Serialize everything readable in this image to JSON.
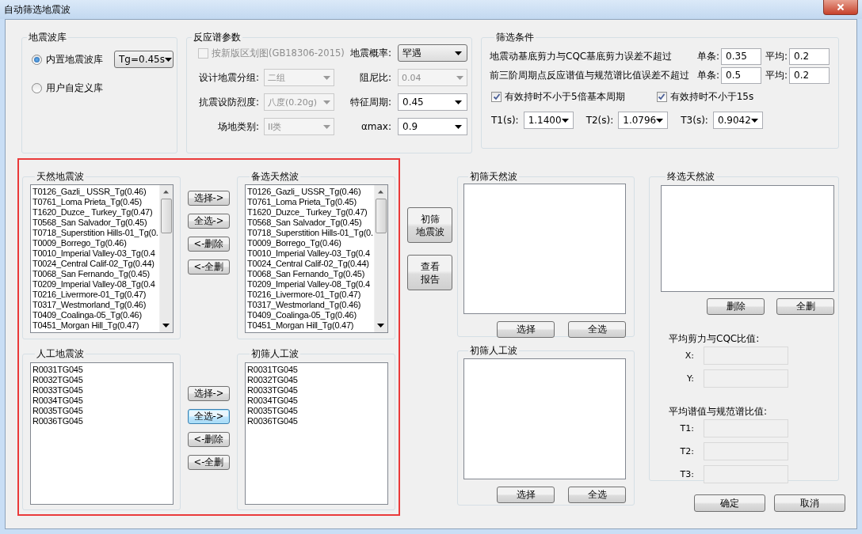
{
  "window": {
    "title": "自动筛选地震波"
  },
  "wave_library": {
    "title": "地震波库",
    "options": [
      {
        "label": "内置地震波库",
        "selected": true
      },
      {
        "label": "用户自定义库",
        "selected": false
      }
    ],
    "tg_select": {
      "value": "Tg=0.45s"
    }
  },
  "spectrum_params": {
    "title": "反应谱参数",
    "new_zoning": {
      "label": "按新版区划图(GB18306-2015)",
      "checked": false,
      "disabled": true
    },
    "left_fields": [
      {
        "label": "设计地震分组:",
        "value": "二组",
        "disabled": true
      },
      {
        "label": "抗震设防烈度:",
        "value": "八度(0.20g)",
        "disabled": true
      },
      {
        "label": "场地类别:",
        "value": "II类",
        "disabled": true
      }
    ],
    "right_fields": [
      {
        "label": "地震概率:",
        "value": "罕遇",
        "disabled": false,
        "kind": "button"
      },
      {
        "label": "阻尼比:",
        "value": "0.04",
        "disabled": true,
        "kind": "edit"
      },
      {
        "label": "特征周期:",
        "value": "0.45",
        "disabled": false,
        "kind": "edit"
      },
      {
        "label": "αmax:",
        "value": "0.9",
        "disabled": false,
        "kind": "edit"
      }
    ]
  },
  "filter": {
    "title": "筛选条件",
    "criteria": [
      {
        "label": "地震动基底剪力与CQC基底剪力误差不超过",
        "single_label": "单条:",
        "single": "0.35",
        "avg_label": "平均:",
        "avg": "0.2"
      },
      {
        "label": "前三阶周期点反应谱值与规范谱比值误差不超过",
        "single_label": "单条:",
        "single": "0.5",
        "avg_label": "平均:",
        "avg": "0.2"
      }
    ],
    "checks": [
      {
        "label": "有效持时不小于5倍基本周期",
        "checked": true
      },
      {
        "label": "有效持时不小于15s",
        "checked": true
      }
    ],
    "periods": [
      {
        "label": "T1(s):",
        "value": "1.1400"
      },
      {
        "label": "T2(s):",
        "value": "1.0796"
      },
      {
        "label": "T3(s):",
        "value": "0.9042"
      }
    ]
  },
  "natural_waves": {
    "title": "天然地震波",
    "items": [
      "T0126_Gazli_ USSR_Tg(0.46)",
      "T0761_Loma Prieta_Tg(0.45)",
      "T1620_Duzce_ Turkey_Tg(0.47)",
      "T0568_San Salvador_Tg(0.45)",
      "T0718_Superstition Hills-01_Tg(0.",
      "T0009_Borrego_Tg(0.46)",
      "T0010_Imperial Valley-03_Tg(0.4",
      "T0024_Central Calif-02_Tg(0.44)",
      "T0068_San Fernando_Tg(0.45)",
      "T0209_Imperial Valley-08_Tg(0.4",
      "T0216_Livermore-01_Tg(0.47)",
      "T0317_Westmorland_Tg(0.46)",
      "T0409_Coalinga-05_Tg(0.46)",
      "T0451_Morgan Hill_Tg(0.47)"
    ]
  },
  "natural_buttons": [
    {
      "label": "选择->",
      "focused": false
    },
    {
      "label": "全选->",
      "focused": false
    },
    {
      "label": "<-删除",
      "focused": false
    },
    {
      "label": "<-全删",
      "focused": false
    }
  ],
  "candidate_natural": {
    "title": "备选天然波",
    "items": [
      "T0126_Gazli_ USSR_Tg(0.46)",
      "T0761_Loma Prieta_Tg(0.45)",
      "T1620_Duzce_ Turkey_Tg(0.47)",
      "T0568_San Salvador_Tg(0.45)",
      "T0718_Superstition Hills-01_Tg(0.",
      "T0009_Borrego_Tg(0.46)",
      "T0010_Imperial Valley-03_Tg(0.4",
      "T0024_Central Calif-02_Tg(0.44)",
      "T0068_San Fernando_Tg(0.45)",
      "T0209_Imperial Valley-08_Tg(0.4",
      "T0216_Livermore-01_Tg(0.47)",
      "T0317_Westmorland_Tg(0.46)",
      "T0409_Coalinga-05_Tg(0.46)",
      "T0451_Morgan Hill_Tg(0.47)"
    ]
  },
  "artificial_waves": {
    "title": "人工地震波",
    "items": [
      "R0031TG045",
      "R0032TG045",
      "R0033TG045",
      "R0034TG045",
      "R0035TG045",
      "R0036TG045"
    ]
  },
  "artificial_buttons": [
    {
      "label": "选择->",
      "focused": false
    },
    {
      "label": "全选->",
      "focused": true
    },
    {
      "label": "<-删除",
      "focused": false
    },
    {
      "label": "<-全删",
      "focused": false
    }
  ],
  "screened_artificial_candidates": {
    "title": "初筛人工波",
    "items": [
      "R0031TG045",
      "R0032TG045",
      "R0033TG045",
      "R0034TG045",
      "R0035TG045",
      "R0036TG045"
    ]
  },
  "action_buttons": [
    {
      "lines": [
        "初筛",
        "地震波"
      ]
    },
    {
      "lines": [
        "查看",
        "报告"
      ]
    }
  ],
  "screened_natural": {
    "title": "初筛天然波",
    "buttons": [
      "选择",
      "全选"
    ]
  },
  "screened_artificial": {
    "title": "初筛人工波",
    "buttons": [
      "选择",
      "全选"
    ]
  },
  "final_natural": {
    "title": "终选天然波",
    "buttons": [
      "删除",
      "全删"
    ],
    "shear_title": "平均剪力与CQC比值:",
    "shear_fields": [
      "X:",
      "Y:"
    ],
    "spectrum_title": "平均谱值与规范谱比值:",
    "spectrum_fields": [
      "T1:",
      "T2:",
      "T3:"
    ]
  },
  "dialog_buttons": [
    "确定",
    "取消"
  ]
}
